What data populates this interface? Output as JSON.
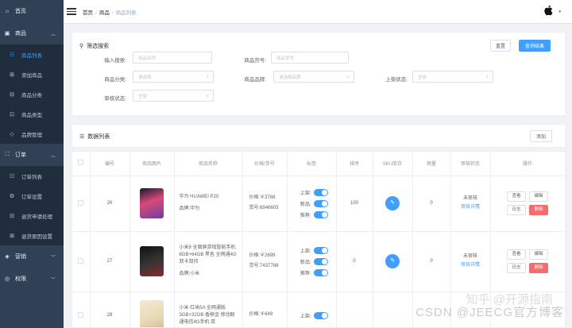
{
  "sidebar": {
    "home": "首页",
    "product": {
      "label": "商品",
      "items": [
        {
          "label": "商品列表",
          "icon": "list-icon",
          "active": true
        },
        {
          "label": "添加商品",
          "icon": "add-icon"
        },
        {
          "label": "商品分类",
          "icon": "category-icon"
        },
        {
          "label": "商品类型",
          "icon": "type-icon"
        },
        {
          "label": "品牌管理",
          "icon": "tag-icon"
        }
      ]
    },
    "order": {
      "label": "订单",
      "items": [
        {
          "label": "订单列表",
          "icon": "list-icon"
        },
        {
          "label": "订单设置",
          "icon": "gear-icon"
        },
        {
          "label": "退货申请处理",
          "icon": "return-icon"
        },
        {
          "label": "退货原因设置",
          "icon": "reason-icon"
        }
      ]
    },
    "marketing": "营销",
    "permission": "权限"
  },
  "header": {
    "breadcrumb": [
      "首页",
      "商品",
      "商品列表"
    ]
  },
  "filter": {
    "title": "筛选搜索",
    "reset_label": "重置",
    "search_label": "查询结果",
    "keyword_label": "输入搜索:",
    "keyword_placeholder": "商品名称",
    "sn_label": "商品货号:",
    "sn_placeholder": "商品货号",
    "category_label": "商品分类:",
    "category_placeholder": "请选择",
    "brand_label": "商品品牌:",
    "brand_placeholder": "请选择品牌",
    "publish_label": "上架状态:",
    "publish_placeholder": "全部",
    "verify_label": "审核状态:",
    "verify_placeholder": "全部"
  },
  "list": {
    "title": "数据列表",
    "add_label": "添加"
  },
  "table": {
    "columns": [
      "编号",
      "商品图片",
      "商品名称",
      "价格/货号",
      "标签",
      "排序",
      "SKU库存",
      "销量",
      "审核状态",
      "操作"
    ],
    "tag_labels": [
      "上架:",
      "新品:",
      "推荐:"
    ],
    "price_prefix": "价格:",
    "sn_prefix": "货号:",
    "brand_prefix": "品牌:",
    "rows": [
      {
        "id": "26",
        "name": "华为 HUAWEI P20",
        "brand": "华为",
        "price": "￥3788",
        "sn": "6946605",
        "sort": "100",
        "sales": "0",
        "status": "未审核",
        "detail": "审核详情",
        "image_color": "#d94a7a"
      },
      {
        "id": "27",
        "name": "小米8 全面屏游戏智能手机 6GB+64GB 黑色 全网通4G 双卡双待",
        "brand": "小米",
        "price": "￥2699",
        "sn": "7437788",
        "sort": "0",
        "sales": "0",
        "status": "未审核",
        "detail": "审核详情",
        "image_color": "#262626"
      },
      {
        "id": "28",
        "name": "小米 红米5A 全网通版 3GB+32GB 香槟金 移动联通电信4G手机 双",
        "brand": "",
        "price": "￥649",
        "sn": "",
        "sort": "",
        "sales": "",
        "status": "",
        "detail": "",
        "image_color": "#e8d9b5"
      }
    ],
    "ops": {
      "view": "查看",
      "edit": "编辑",
      "log": "日志",
      "delete": "删除"
    }
  },
  "watermark": {
    "line1": "知乎 @开源指南",
    "line2": "CSDN @JEECG官方博客"
  },
  "colors": {
    "sidebar": "#304156",
    "sidebar_sub": "#1f2d3d",
    "primary": "#409eff",
    "danger": "#f56c6c"
  }
}
